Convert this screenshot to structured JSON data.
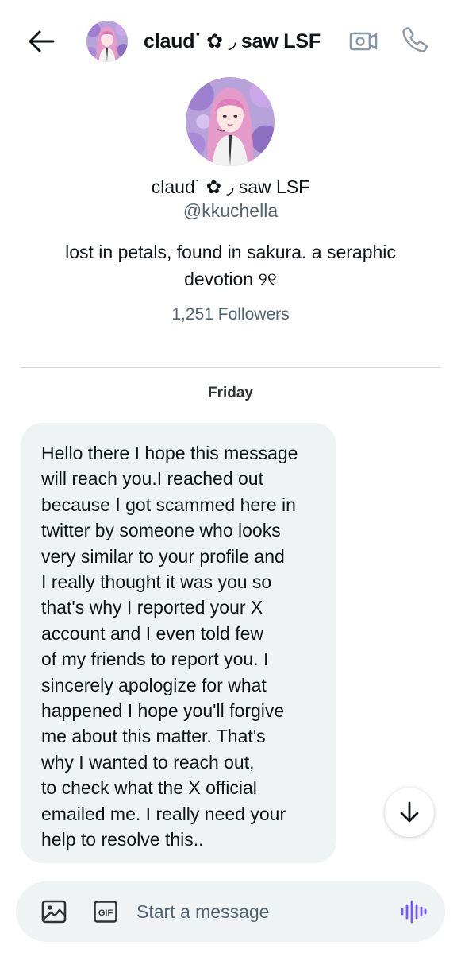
{
  "header": {
    "display_name": "claud˙ ✿ ◞ saw LSF",
    "icons": {
      "back": "arrow-left-icon",
      "video": "video-camera-icon",
      "call": "phone-icon"
    }
  },
  "profile": {
    "display_name": "claud˙ ✿ ◞ saw LSF",
    "handle": "@kkuchella",
    "bio_lines": [
      "lost in petals, found in sakura. a seraphic",
      "devotion ୨୧"
    ],
    "followers": "1,251 Followers"
  },
  "conversation": {
    "day_label": "Friday",
    "message_lines": [
      "Hello there I hope this message",
      "will reach you.I reached out",
      "because I got scammed here in",
      "twitter by someone who looks",
      "very similar to your profile and",
      "I really thought it was you so",
      "that's why I reported your X",
      "account and I even told few",
      "of my friends to report you. I",
      "sincerely apologize for what",
      "happened I hope you'll forgive",
      "me about this matter. That's",
      "why I wanted to reach out,",
      "to check what the X official",
      "emailed me. I really need your",
      "help to resolve this.."
    ]
  },
  "composer": {
    "placeholder": "Start a message",
    "gif_label": "GIF",
    "icons": {
      "image": "image-icon",
      "gif": "gif-icon",
      "voice": "voice-waveform-icon",
      "scroll": "arrow-down-icon"
    }
  },
  "colors": {
    "text_primary": "#0f1419",
    "text_secondary": "#536471",
    "bubble_bg": "#eff3f4",
    "accent_voice": "#7856ff",
    "icon_gray": "#7a8791"
  }
}
